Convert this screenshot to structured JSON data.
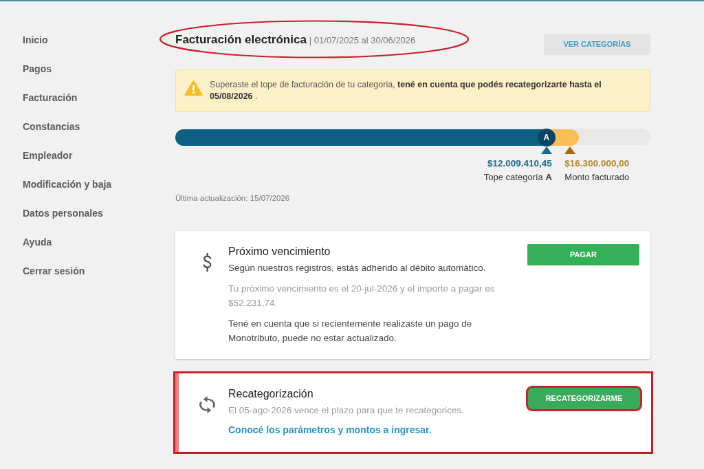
{
  "sidebar": {
    "items": [
      {
        "label": "Inicio"
      },
      {
        "label": "Pagos"
      },
      {
        "label": "Facturación"
      },
      {
        "label": "Constancias"
      },
      {
        "label": "Empleador"
      },
      {
        "label": "Modificación y baja"
      },
      {
        "label": "Datos personales"
      },
      {
        "label": "Ayuda"
      },
      {
        "label": "Cerrar sesión"
      }
    ]
  },
  "header": {
    "title": "Facturación electrónica",
    "period": "| 01/07/2025 al 30/06/2026",
    "highlighted": true,
    "button": "VER CATEGORÍAS"
  },
  "alert": {
    "kind": "warning",
    "text": "Superaste el tope de facturación de tu categoria, **tené en cuenta que podés recategorizarte hasta el 05/08/2026** ."
  },
  "billing_bar": {
    "segments": [
      {
        "kind": "cap",
        "color": "#0e5f84",
        "level": 0.8,
        "badge": "A",
        "amount": "$12.009.410,45",
        "label": "Tope categoría **A**"
      },
      {
        "kind": "billed",
        "color": "#fbbf57",
        "level": 0.85,
        "amount": "$16.300.000,00",
        "label": "Monto facturado"
      }
    ],
    "updated": "Última actualización: 15/07/2026"
  },
  "cards": [
    {
      "kind": "payment",
      "title": "Próximo vencimiento",
      "paragraphs": [
        {
          "kind": "normal",
          "text": "Según nuestros registros, estás adherido al débito automático."
        },
        {
          "kind": "muted",
          "text": "Tu próximo vencimiento es el 20-jul-2026 y el importe a pagar es $52.231,74."
        },
        {
          "kind": "normal",
          "text": "Tené en cuenta que si recientemente realizaste un pago de Monotributo, puede no estar actualizado."
        }
      ],
      "button": {
        "label": "PAGAR",
        "highlighted": false
      },
      "highlighted": false
    },
    {
      "kind": "recategorization",
      "title": "Recategorización",
      "paragraphs": [
        {
          "kind": "muted",
          "text": "El 05-ago-2026 vence el plazo para que te recategorices."
        }
      ],
      "link": "Conocé los parámetros y montos a ingresar.",
      "button": {
        "label": "RECATEGORIZARME",
        "highlighted": true
      },
      "highlighted": true
    }
  ]
}
